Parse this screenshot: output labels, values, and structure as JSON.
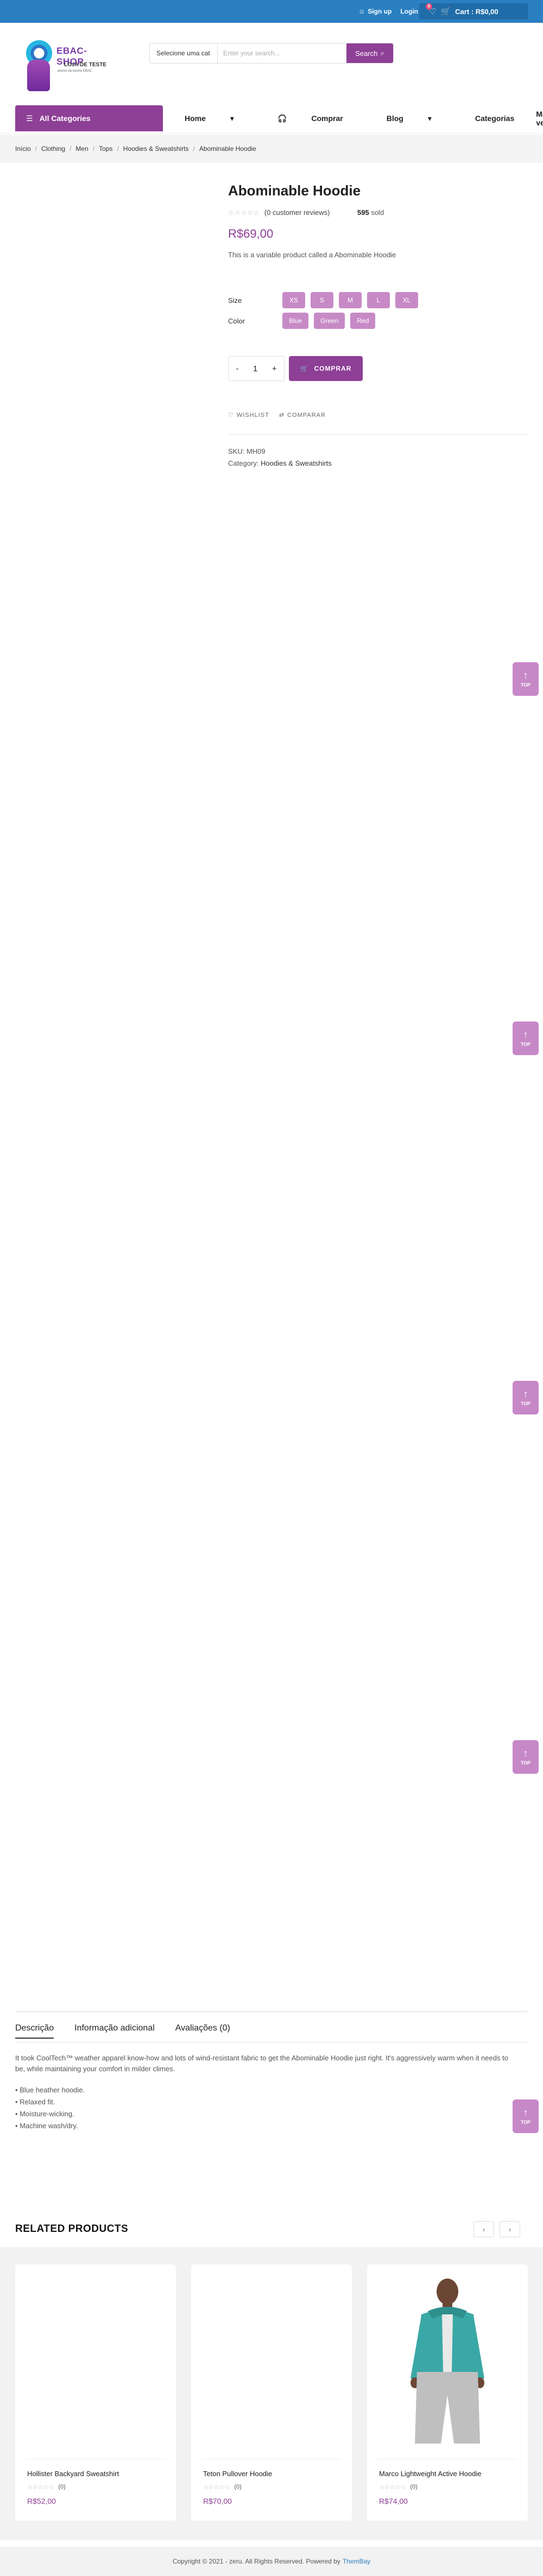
{
  "topbar": {
    "signup": "Sign up",
    "login": "Login",
    "cart_count": "0",
    "cart_label": "Cart : R$0,00"
  },
  "logo": {
    "name": "EBAC-SHOP",
    "sub": "LOJA DE TESTE",
    "tagline": "alunos da escola EBAC"
  },
  "search": {
    "category": "Selecione uma cat",
    "placeholder": "Enter your search...",
    "button": "Search"
  },
  "nav": {
    "all_categories": "All Categories",
    "items": [
      "Home",
      "Comprar",
      "Blog",
      "Categorias",
      "Mais vendidos"
    ]
  },
  "breadcrumb": [
    "Início",
    "Clothing",
    "Men",
    "Tops",
    "Hoodies & Sweatshirts",
    "Abominable Hoodie"
  ],
  "product": {
    "title": "Abominable Hoodie",
    "reviews": "(0 customer reviews)",
    "sold_count": "595",
    "sold_label": "sold",
    "price": "R$69,00",
    "description": "This is a variable product called a Abominable Hoodie",
    "size_label": "Size",
    "sizes": [
      "XS",
      "S",
      "M",
      "L",
      "XL"
    ],
    "color_label": "Color",
    "colors": [
      "Blue",
      "Green",
      "Red"
    ],
    "quantity": "1",
    "buy_button": "COMPRAR",
    "wishlist": "WISHLIST",
    "compare": "COMPARAR",
    "sku_label": "SKU:",
    "sku": "MH09",
    "category_label": "Category:",
    "category": "Hoodies & Sweatshirts"
  },
  "scroll_top_label": "TOP",
  "tabs": {
    "items": [
      "Descrição",
      "Informação adicional",
      "Avaliações (0)"
    ],
    "description": "It took CoolTech™ weather apparel know-how and lots of wind-resistant fabric to get the Abominable Hoodie just right. It's aggressively warm when it needs to be, while maintaining your comfort in milder climes.",
    "bullets": [
      "• Blue heather hoodie.",
      "• Relaxed fit.",
      "• Moisture-wicking.",
      "• Machine wash/dry."
    ]
  },
  "related": {
    "heading": "RELATED PRODUCTS",
    "products": [
      {
        "name": "Hollister Backyard Sweatshirt",
        "count": "(0)",
        "price": "R$52,00"
      },
      {
        "name": "Teton Pullover Hoodie",
        "count": "(0)",
        "price": "R$70,00"
      },
      {
        "name": "Marco Lightweight Active Hoodie",
        "count": "(0)",
        "price": "R$74,00"
      }
    ]
  },
  "footer": {
    "text": "Copyright © 2021 - zeru. All Rights Reserved. Powered by",
    "powered": "ThemBay"
  },
  "colors": {
    "accent": "#8e3f96",
    "topbar": "#2a7fc1",
    "swatch": "#c78ac6"
  }
}
